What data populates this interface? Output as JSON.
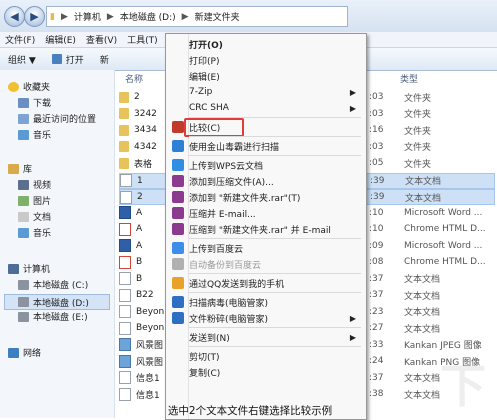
{
  "address": {
    "back_arrow": "◀",
    "forward_arrow": "▶",
    "crumbs": [
      "计算机",
      "本地磁盘 (D:)",
      "新建文件夹"
    ],
    "separator": "▶"
  },
  "menubar": [
    "文件(F)",
    "编辑(E)",
    "查看(V)",
    "工具(T)"
  ],
  "toolbar": {
    "organize": "组织 ▼",
    "open": "打开",
    "new_partial": "新"
  },
  "navpane": {
    "favorites": "收藏夹",
    "fav_items": [
      "下载",
      "最近访问的位置",
      "音乐"
    ],
    "library": "库",
    "lib_items": [
      "视频",
      "图片",
      "文档",
      "音乐"
    ],
    "computer": "计算机",
    "drives": [
      "本地磁盘 (C:)",
      "本地磁盘 (D:)",
      "本地磁盘 (E:)"
    ],
    "network": "网络"
  },
  "filelist": {
    "col_name": "名称",
    "col_type": "类型",
    "rows": [
      {
        "name": "2",
        "date": ":03",
        "type": "文件夹",
        "kind": "folder"
      },
      {
        "name": "3242",
        "date": ":03",
        "type": "文件夹",
        "kind": "folder"
      },
      {
        "name": "3434",
        "date": ":16",
        "type": "文件夹",
        "kind": "folder"
      },
      {
        "name": "4342",
        "date": ":03",
        "type": "文件夹",
        "kind": "folder"
      },
      {
        "name": "表格",
        "date": ":05",
        "type": "文件夹",
        "kind": "folder"
      },
      {
        "name": "1",
        "date": ":39",
        "type": "文本文档",
        "kind": "text",
        "selected": true
      },
      {
        "name": "2",
        "date": ":39",
        "type": "文本文档",
        "kind": "text",
        "selected": true
      },
      {
        "name": "A",
        "date": ":10",
        "type": "Microsoft Word ...",
        "kind": "doc"
      },
      {
        "name": "A",
        "date": ":10",
        "type": "Chrome HTML D...",
        "kind": "html"
      },
      {
        "name": "A",
        "date": ":09",
        "type": "Microsoft Word ...",
        "kind": "doc"
      },
      {
        "name": "B",
        "date": ":08",
        "type": "Chrome HTML D...",
        "kind": "html"
      },
      {
        "name": "B",
        "date": ":37",
        "type": "文本文档",
        "kind": "text"
      },
      {
        "name": "B22",
        "date": ":37",
        "type": "文本文档",
        "kind": "text"
      },
      {
        "name": "Beyon",
        "date": ":23",
        "type": "文本文档",
        "kind": "text"
      },
      {
        "name": "Beyon",
        "date": ":27",
        "type": "文本文档",
        "kind": "text"
      },
      {
        "name": "风景图",
        "date": ":33",
        "type": "Kankan JPEG 图像",
        "kind": "img"
      },
      {
        "name": "风景图",
        "date": ":24",
        "type": "Kankan PNG 图像",
        "kind": "img"
      },
      {
        "name": "信息1",
        "date": ":37",
        "type": "文本文档",
        "kind": "text"
      },
      {
        "name": "信息1",
        "date": ":38",
        "type": "文本文档",
        "kind": "text"
      }
    ]
  },
  "context_menu": {
    "items": [
      {
        "label": "打开(O)",
        "bold": true
      },
      {
        "label": "打印(P)"
      },
      {
        "label": "编辑(E)"
      },
      {
        "label": "7-Zip",
        "submenu": true
      },
      {
        "label": "CRC SHA",
        "submenu": true
      },
      {
        "sep": true
      },
      {
        "label": "比较(C)",
        "icon": "compare-icon",
        "icon_color": "#c0392b",
        "highlight": true
      },
      {
        "sep": true
      },
      {
        "label": "使用金山毒霸进行扫描",
        "icon": "kingsoft-shield-icon",
        "icon_color": "#2e7fd6"
      },
      {
        "sep": true
      },
      {
        "label": "上传到WPS云文档",
        "icon": "wps-cloud-icon",
        "icon_color": "#2f8de4"
      },
      {
        "label": "添加到压缩文件(A)...",
        "icon": "rar-archive-icon",
        "icon_color": "#8b3a8f"
      },
      {
        "label": "添加到 \"新建文件夹.rar\"(T)",
        "icon": "rar-archive-icon",
        "icon_color": "#8b3a8f"
      },
      {
        "label": "压缩并 E-mail...",
        "icon": "rar-archive-icon",
        "icon_color": "#8b3a8f"
      },
      {
        "label": "压缩到 \"新建文件夹.rar\" 并 E-mail",
        "icon": "rar-archive-icon",
        "icon_color": "#8b3a8f"
      },
      {
        "sep": true
      },
      {
        "label": "上传到百度云",
        "icon": "baidu-cloud-icon",
        "icon_color": "#3d8ee8"
      },
      {
        "label": "自动备份到百度云",
        "icon": "baidu-backup-icon",
        "icon_color": "#b0b0b0",
        "disabled": true
      },
      {
        "sep": true
      },
      {
        "label": "通过QQ发送到我的手机",
        "icon": "qq-icon",
        "icon_color": "#e8a22a"
      },
      {
        "sep": true
      },
      {
        "label": "扫描病毒(电脑管家)",
        "icon": "pc-manager-scan-icon",
        "icon_color": "#2e6fc4"
      },
      {
        "label": "文件粉碎(电脑管家)",
        "icon": "pc-manager-shred-icon",
        "icon_color": "#2e6fc4",
        "submenu": true
      },
      {
        "sep": true
      },
      {
        "label": "发送到(N)",
        "submenu": true
      },
      {
        "sep": true
      },
      {
        "label": "剪切(T)"
      },
      {
        "label": "复制(C)"
      }
    ]
  },
  "caption": "选中2个文本文件右键选择比较示例",
  "colors": {
    "highlight_border": "#e23b3b",
    "selection": "#cde0f6",
    "folder": "#e8c25a"
  }
}
